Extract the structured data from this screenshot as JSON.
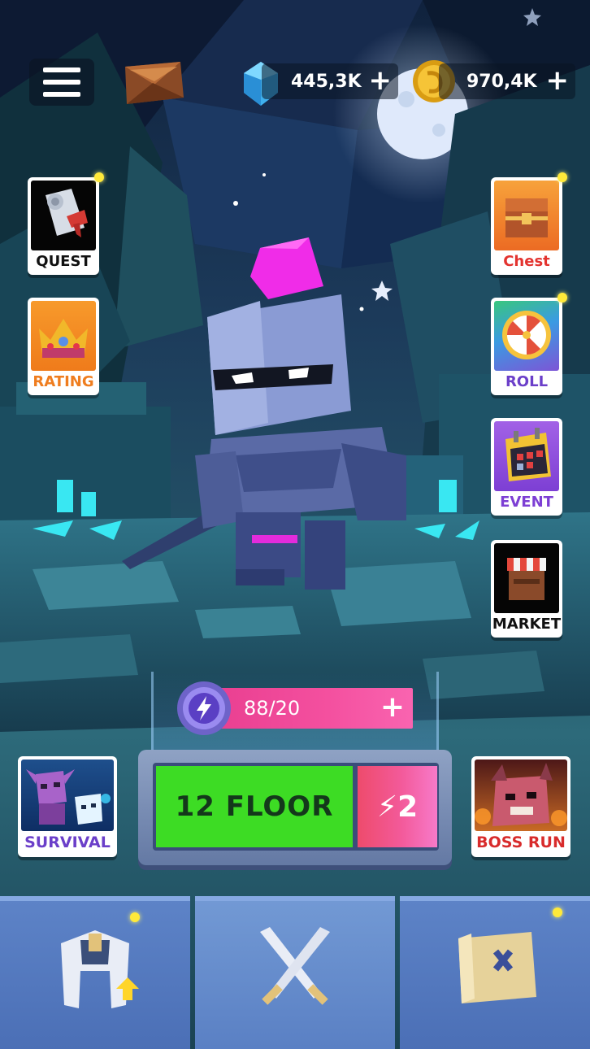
{
  "top_bar": {
    "gems": "445,3K",
    "coins": "970,4K",
    "plus": "+"
  },
  "left_tiles": {
    "quest": "QUEST",
    "rating": "RATING"
  },
  "right_tiles": {
    "chest": "Chest",
    "roll": "ROLL",
    "event": "EVENT",
    "market": "MARKET"
  },
  "energy": {
    "value": "88/20",
    "plus": "+"
  },
  "play": {
    "label": "12 FLOOR",
    "cost": "⚡2"
  },
  "modes": {
    "survival": "SURVIVAL",
    "boss_run": "BOSS RUN"
  },
  "colors": {
    "play_green": "#3ddc24",
    "energy_pink": "#f4509f",
    "notification_dot": "#ffe93a"
  }
}
